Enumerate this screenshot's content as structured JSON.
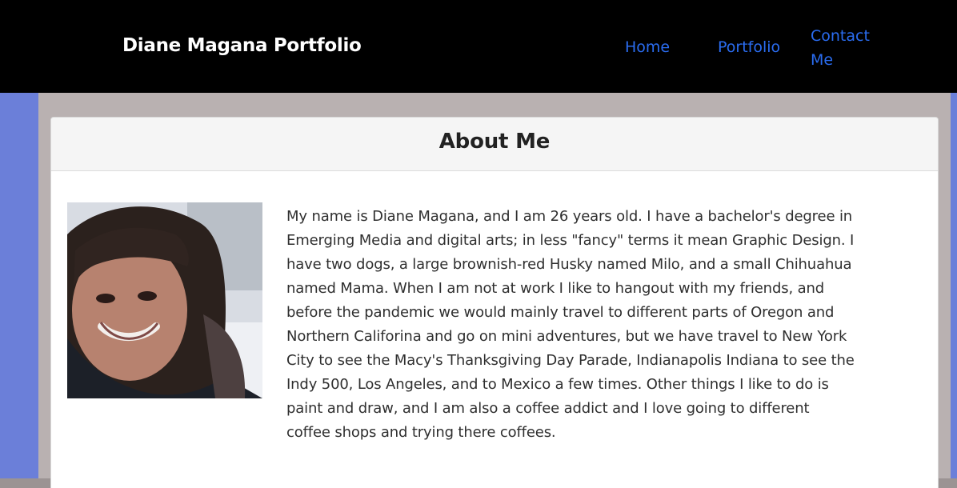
{
  "navbar": {
    "brand": "Diane Magana Portfolio",
    "links": [
      {
        "label": "Home"
      },
      {
        "label": "Portfolio"
      },
      {
        "label": "Contact Me"
      }
    ]
  },
  "about": {
    "title": "About Me",
    "photo_alt": "Photo of Diane Magana",
    "bio": "My name is Diane Magana, and I am 26 years old. I have a bachelor's degree in Emerging Media and digital arts; in less \"fancy\" terms it mean Graphic Design. I have two dogs, a large brownish-red Husky named Milo, and a small Chihuahua named Mama. When I am not at work I like to hangout with my friends, and before the pandemic we would mainly travel to different parts of Oregon and Northern Califorina and go on mini adventures, but we have travel to New York City to see the Macy's Thanksgiving Day Parade, Indianapolis Indiana to see the Indy 500, Los Angeles, and to Mexico a few times. Other things I like to do is paint and draw, and I am also a coffee addict and I love going to different coffee shops and trying there coffees."
  },
  "colors": {
    "navbar_bg": "#000000",
    "brand_text": "#ffffff",
    "link": "#2a6cf0",
    "page_bg": "#6b7fd9",
    "container_bg": "#b9b1b1",
    "card_bg": "#ffffff",
    "card_header_bg": "#f5f5f5"
  }
}
